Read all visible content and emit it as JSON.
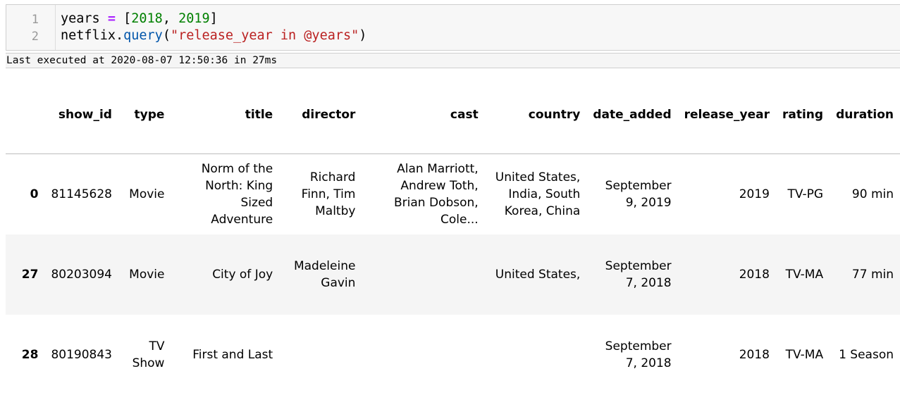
{
  "code_cell": {
    "line_numbers": [
      "1",
      "2"
    ],
    "line1": {
      "var": "years",
      "eq": " = ",
      "open": "[",
      "n1": "2018",
      "comma": ", ",
      "n2": "2019",
      "close": "]"
    },
    "line2": {
      "obj": "netflix.",
      "fn": "query",
      "open": "(",
      "str": "\"release_year in @years\"",
      "close": ")"
    }
  },
  "exec_time": "Last executed at 2020-08-07 12:50:36 in 27ms",
  "table": {
    "columns": [
      "",
      "show_id",
      "type",
      "title",
      "director",
      "cast",
      "country",
      "date_added",
      "release_year",
      "rating",
      "duration"
    ],
    "rows": [
      {
        "index": "0",
        "show_id": "81145628",
        "type": "Movie",
        "title": "Norm of the North: King Sized Adventure",
        "director": "Richard Finn, Tim Maltby",
        "cast": "Alan Marriott, Andrew Toth, Brian Dobson, Cole...",
        "country": "United States, India, South Korea, China",
        "date_added": "September 9, 2019",
        "release_year": "2019",
        "rating": "TV-PG",
        "duration": "90 min"
      },
      {
        "index": "27",
        "show_id": "80203094",
        "type": "Movie",
        "title": "City of Joy",
        "director": "Madeleine Gavin",
        "cast": "",
        "country": "United States,",
        "date_added": "September 7, 2018",
        "release_year": "2018",
        "rating": "TV-MA",
        "duration": "77 min"
      },
      {
        "index": "28",
        "show_id": "80190843",
        "type": "TV Show",
        "title": "First and Last",
        "director": "",
        "cast": "",
        "country": "",
        "date_added": "September 7, 2018",
        "release_year": "2018",
        "rating": "TV-MA",
        "duration": "1 Season"
      }
    ]
  }
}
